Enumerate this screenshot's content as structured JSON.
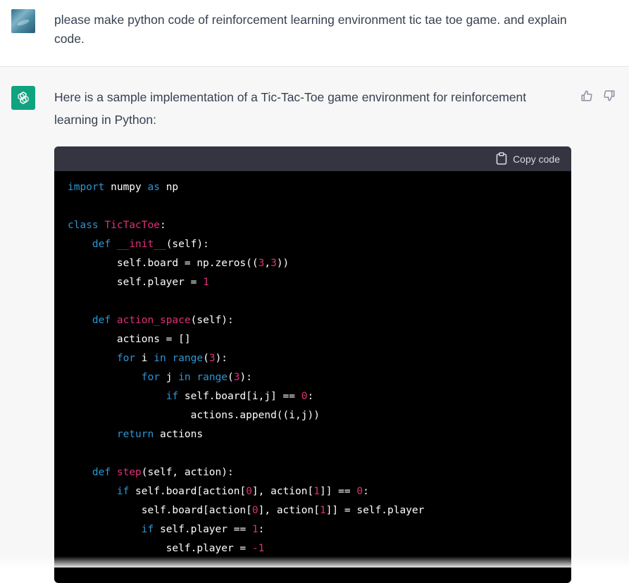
{
  "user_message": {
    "text": "please make python code of reinforcement learning environment tic tae toe game. and explain code."
  },
  "assistant_message": {
    "intro": "Here is a sample implementation of a Tic-Tac-Toe game environment for reinforcement learning in Python:",
    "feedback": {
      "up_icon": "thumbs-up-icon",
      "down_icon": "thumbs-down-icon"
    }
  },
  "code_block": {
    "copy_label": "Copy code",
    "lines": [
      [
        {
          "t": "import",
          "c": "kw"
        },
        {
          "t": " numpy "
        },
        {
          "t": "as",
          "c": "kw"
        },
        {
          "t": " np"
        }
      ],
      [],
      [
        {
          "t": "class",
          "c": "kw"
        },
        {
          "t": " "
        },
        {
          "t": "TicTacToe",
          "c": "fn"
        },
        {
          "t": ":"
        }
      ],
      [
        {
          "t": "    "
        },
        {
          "t": "def",
          "c": "kw"
        },
        {
          "t": " "
        },
        {
          "t": "__init__",
          "c": "fn"
        },
        {
          "t": "(self):"
        }
      ],
      [
        {
          "t": "        self.board = np.zeros(("
        },
        {
          "t": "3",
          "c": "num"
        },
        {
          "t": ","
        },
        {
          "t": "3",
          "c": "num"
        },
        {
          "t": "))"
        }
      ],
      [
        {
          "t": "        self.player = "
        },
        {
          "t": "1",
          "c": "num"
        }
      ],
      [],
      [
        {
          "t": "    "
        },
        {
          "t": "def",
          "c": "kw"
        },
        {
          "t": " "
        },
        {
          "t": "action_space",
          "c": "fn"
        },
        {
          "t": "(self):"
        }
      ],
      [
        {
          "t": "        actions = []"
        }
      ],
      [
        {
          "t": "        "
        },
        {
          "t": "for",
          "c": "kw"
        },
        {
          "t": " i "
        },
        {
          "t": "in",
          "c": "kw"
        },
        {
          "t": " "
        },
        {
          "t": "range",
          "c": "kw"
        },
        {
          "t": "("
        },
        {
          "t": "3",
          "c": "num"
        },
        {
          "t": "):"
        }
      ],
      [
        {
          "t": "            "
        },
        {
          "t": "for",
          "c": "kw"
        },
        {
          "t": " j "
        },
        {
          "t": "in",
          "c": "kw"
        },
        {
          "t": " "
        },
        {
          "t": "range",
          "c": "kw"
        },
        {
          "t": "("
        },
        {
          "t": "3",
          "c": "num"
        },
        {
          "t": "):"
        }
      ],
      [
        {
          "t": "                "
        },
        {
          "t": "if",
          "c": "kw"
        },
        {
          "t": " self.board[i,j] == "
        },
        {
          "t": "0",
          "c": "num"
        },
        {
          "t": ":"
        }
      ],
      [
        {
          "t": "                    actions.append((i,j))"
        }
      ],
      [
        {
          "t": "        "
        },
        {
          "t": "return",
          "c": "kw"
        },
        {
          "t": " actions"
        }
      ],
      [],
      [
        {
          "t": "    "
        },
        {
          "t": "def",
          "c": "kw"
        },
        {
          "t": " "
        },
        {
          "t": "step",
          "c": "fn"
        },
        {
          "t": "(self, action):"
        }
      ],
      [
        {
          "t": "        "
        },
        {
          "t": "if",
          "c": "kw"
        },
        {
          "t": " self.board[action["
        },
        {
          "t": "0",
          "c": "num"
        },
        {
          "t": "], action["
        },
        {
          "t": "1",
          "c": "num"
        },
        {
          "t": "]] == "
        },
        {
          "t": "0",
          "c": "num"
        },
        {
          "t": ":"
        }
      ],
      [
        {
          "t": "            self.board[action["
        },
        {
          "t": "0",
          "c": "num"
        },
        {
          "t": "], action["
        },
        {
          "t": "1",
          "c": "num"
        },
        {
          "t": "]] = self.player"
        }
      ],
      [
        {
          "t": "            "
        },
        {
          "t": "if",
          "c": "kw"
        },
        {
          "t": " self.player == "
        },
        {
          "t": "1",
          "c": "num"
        },
        {
          "t": ":"
        }
      ],
      [
        {
          "t": "                self.player = "
        },
        {
          "t": "-1",
          "c": "num"
        }
      ]
    ]
  },
  "colors": {
    "keyword": "#2e95d3",
    "name": "#df3079",
    "brand": "#10a37f"
  }
}
